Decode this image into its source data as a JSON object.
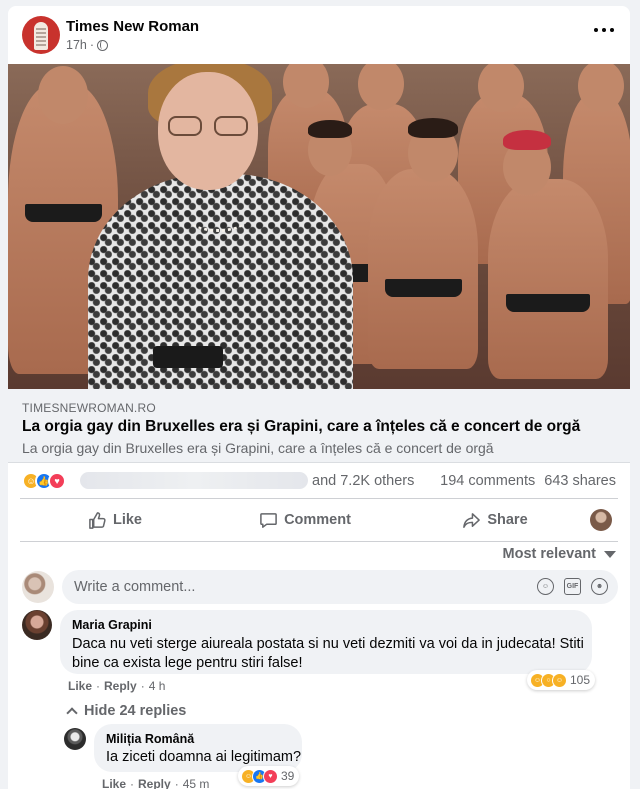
{
  "post": {
    "page_name": "Times New Roman",
    "time": "17h",
    "separator": "·",
    "visibility_icon": "globe-icon"
  },
  "link": {
    "domain": "TIMESNEWROMAN.RO",
    "title": "La orgia gay din Bruxelles era și Grapini, care a înțeles că e concert de orgă",
    "description": "La orgia gay din Bruxelles era și Grapini, care a înțeles că e concert de orgă"
  },
  "stats": {
    "reactions": [
      "haha",
      "like",
      "love"
    ],
    "others_text": "and 7.2K others",
    "comments": "194 comments",
    "shares": "643 shares"
  },
  "actions": {
    "like": "Like",
    "comment": "Comment",
    "share": "Share"
  },
  "comments_section": {
    "sort_label": "Most relevant",
    "compose_placeholder": "Write a comment...",
    "hide_replies": "Hide 24 replies"
  },
  "comments": [
    {
      "author": "Maria Grapini",
      "text": "Daca nu veti sterge aiureala postata si nu veti dezmiti va voi da in judecata! Stiti bine ca exista lege pentru stiri false!",
      "like": "Like",
      "reply": "Reply",
      "dot": "·",
      "time": "4 h",
      "reaction_count": "105"
    },
    {
      "author": "Miliția Română",
      "text": "Ia ziceti doamna ai legitimam?",
      "like": "Like",
      "reply": "Reply",
      "dot": "·",
      "time": "45 m",
      "reaction_count": "39"
    }
  ],
  "colors": {
    "facebook_blue": "#1877f2",
    "secondary_text": "#65676b",
    "background": "#f0f2f5"
  }
}
